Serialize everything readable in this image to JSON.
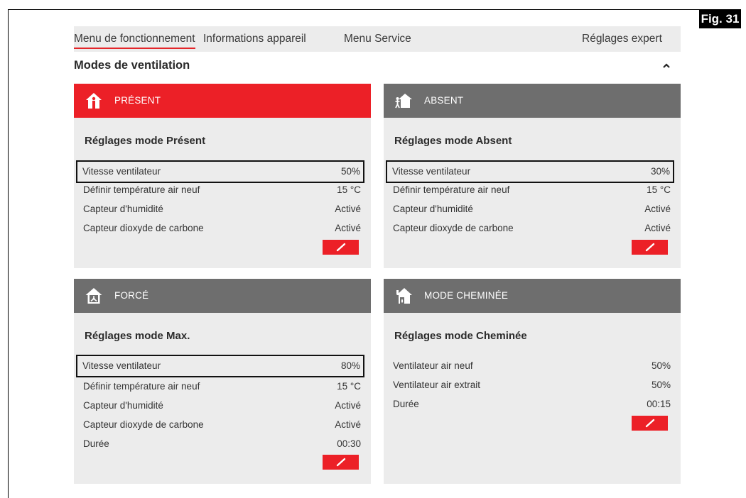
{
  "figure_label": "Fig. 31",
  "nav": {
    "items": [
      {
        "label": "Menu de fonctionnement",
        "active": true
      },
      {
        "label": "Informations appareil"
      },
      {
        "label": "Menu Service"
      },
      {
        "label": "Réglages expert"
      }
    ]
  },
  "section": {
    "title": "Modes de ventilation",
    "collapse_icon": "chevron-up-icon"
  },
  "cards": {
    "present": {
      "header": "PRÉSENT",
      "icon": "home-person-icon",
      "header_color": "#ec2027",
      "subtitle": "Réglages mode Présent",
      "rows": [
        {
          "label": "Vitesse ventilateur",
          "value": "50%"
        },
        {
          "label": "Définir température air neuf",
          "value": "15 °C"
        },
        {
          "label": "Capteur d'humidité",
          "value": "Activé"
        },
        {
          "label": "Capteur dioxyde de carbone",
          "value": "Activé"
        }
      ]
    },
    "absent": {
      "header": "ABSENT",
      "icon": "home-away-icon",
      "header_color": "#6e6e6e",
      "subtitle": "Réglages mode Absent",
      "rows": [
        {
          "label": "Vitesse ventilateur",
          "value": "30%"
        },
        {
          "label": "Définir température air neuf",
          "value": "15 °C"
        },
        {
          "label": "Capteur d'humidité",
          "value": "Activé"
        },
        {
          "label": "Capteur dioxyde de carbone",
          "value": "Activé"
        }
      ]
    },
    "force": {
      "header": "FORCÉ",
      "icon": "home-fan-icon",
      "header_color": "#6e6e6e",
      "subtitle": "Réglages mode Max.",
      "rows": [
        {
          "label": "Vitesse ventilateur",
          "value": "80%"
        },
        {
          "label": "Définir température air neuf",
          "value": "15 °C"
        },
        {
          "label": "Capteur d'humidité",
          "value": "Activé"
        },
        {
          "label": "Capteur dioxyde de carbone",
          "value": "Activé"
        },
        {
          "label": "Durée",
          "value": "00:30"
        }
      ]
    },
    "cheminee": {
      "header": "MODE CHEMINÉE",
      "icon": "home-fireplace-icon",
      "header_color": "#6e6e6e",
      "subtitle": "Réglages mode Cheminée",
      "rows": [
        {
          "label": "Ventilateur air neuf",
          "value": "50%"
        },
        {
          "label": "Ventilateur air extrait",
          "value": "50%"
        },
        {
          "label": "Durée",
          "value": "00:15"
        }
      ]
    }
  },
  "edit_icon": "pencil-icon",
  "accent_color": "#ec2027"
}
